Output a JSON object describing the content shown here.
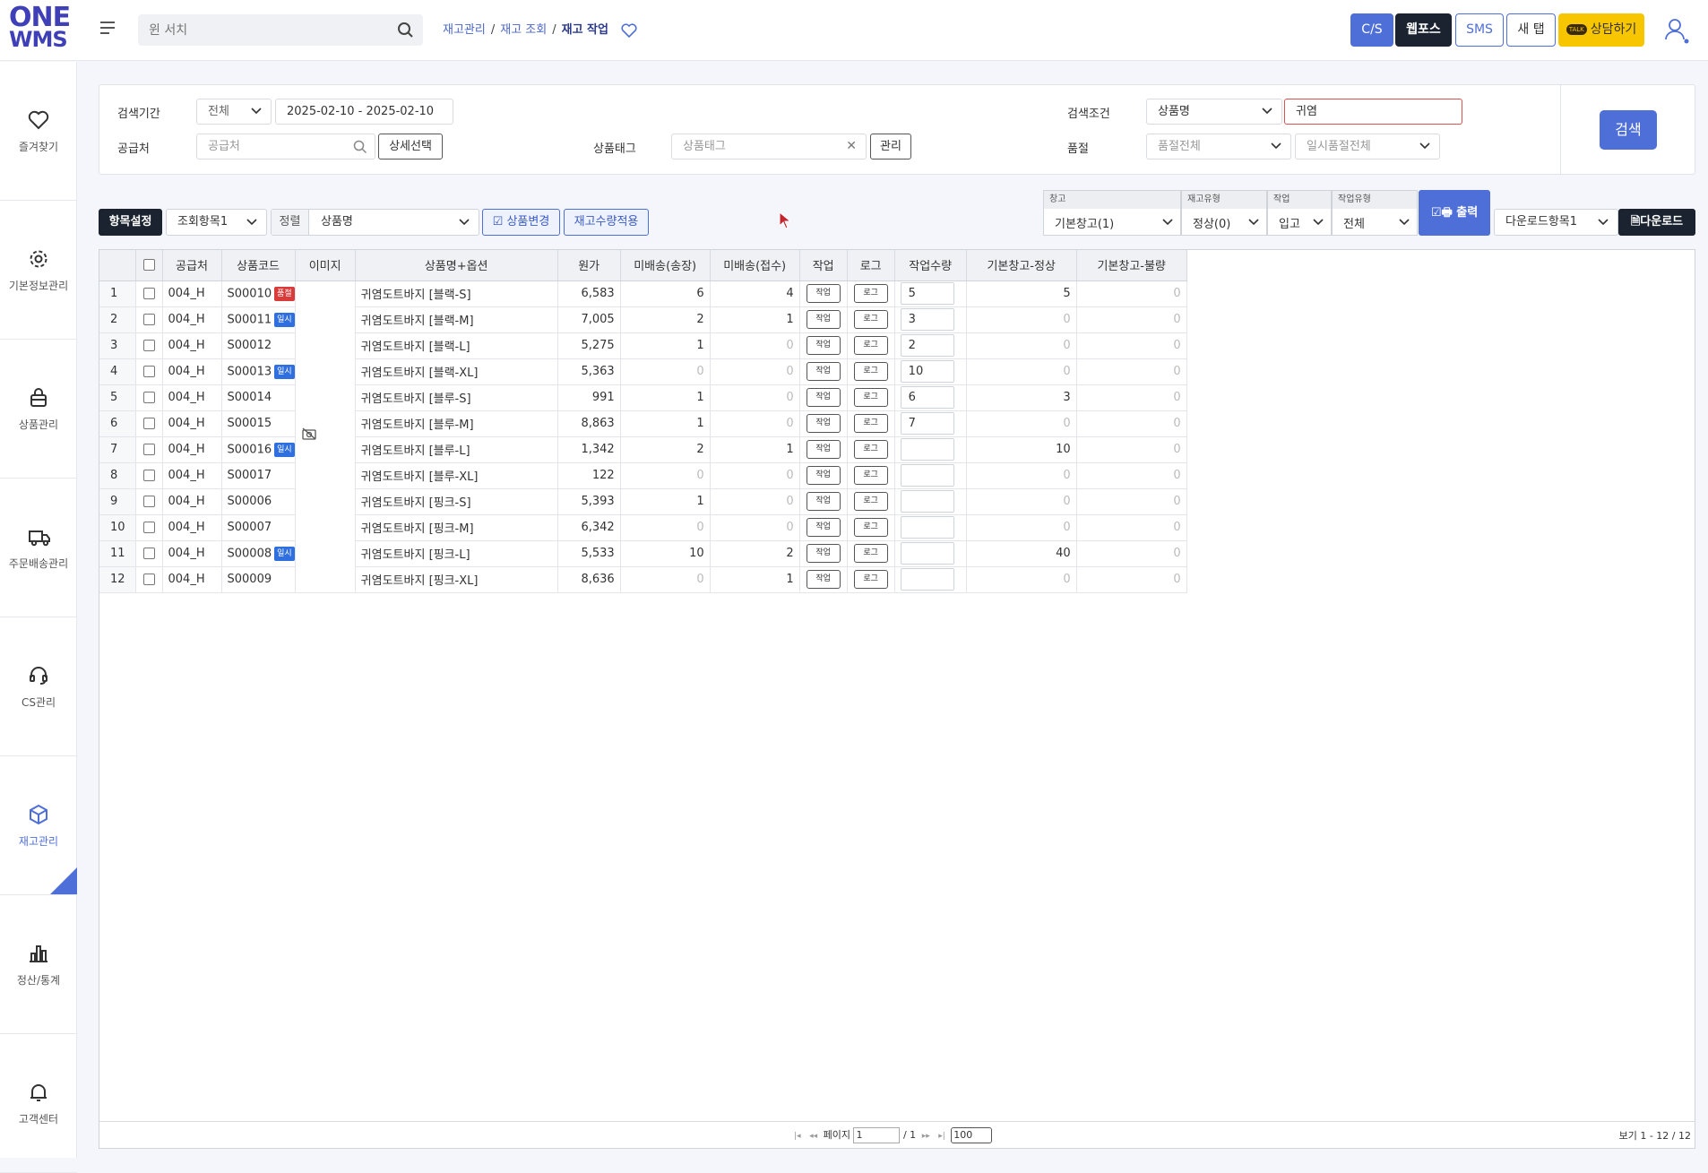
{
  "header": {
    "logo_line1": "ONE",
    "logo_line2": "WMS",
    "search_placeholder": "윈 서치",
    "breadcrumb": [
      "재고관리",
      "재고 조회",
      "재고 작업"
    ],
    "buttons": {
      "cs": "C/S",
      "webforce": "웹포스",
      "sms": "SMS",
      "new_tab": "새 탭",
      "talk_badge": "TALK",
      "consult": "상담하기"
    }
  },
  "sidebar": {
    "items": [
      {
        "label": "즐겨찾기",
        "icon": "heart-icon"
      },
      {
        "label": "기본정보관리",
        "icon": "gear-icon"
      },
      {
        "label": "상품관리",
        "icon": "bag-icon"
      },
      {
        "label": "주문배송관리",
        "icon": "truck-icon"
      },
      {
        "label": "CS관리",
        "icon": "headset-icon"
      },
      {
        "label": "재고관리",
        "icon": "box-icon",
        "active": true
      },
      {
        "label": "정산/통계",
        "icon": "bar-chart-icon"
      },
      {
        "label": "고객센터",
        "icon": "bell-icon"
      }
    ]
  },
  "filters": {
    "period_label": "검색기간",
    "period_select": "전체",
    "period_range": "2025-02-10 - 2025-02-10",
    "supplier_label": "공급처",
    "supplier_placeholder": "공급처",
    "detail_select": "상세선택",
    "tag_label": "상품태그",
    "tag_placeholder": "상품태그",
    "manage": "관리",
    "condition_label": "검색조건",
    "condition_select": "상품명",
    "condition_value": "귀염",
    "soldout_label": "품절",
    "soldout_all": "품절전체",
    "temp_soldout_all": "일시품절전체",
    "search_button": "검색"
  },
  "toolbar": {
    "item_setting": "항목설정",
    "view_item": "조회항목1",
    "sort_label": "정렬",
    "sort_value": "상품명",
    "product_change": "상품변경",
    "apply_stock": "재고수량적용",
    "warehouse_label": "창고",
    "warehouse_value": "기본창고(1)",
    "stock_type_label": "재고유형",
    "stock_type_value": "정상(0)",
    "work_label": "작업",
    "work_value": "입고",
    "work_type_label": "작업유형",
    "work_type_value": "전체",
    "print": "출력",
    "download_item": "다운로드항목1",
    "download": "다운로드"
  },
  "table": {
    "columns": [
      "공급처",
      "상품코드",
      "이미지",
      "상품명+옵션",
      "원가",
      "미배송(송장)",
      "미배송(접수)",
      "작업",
      "로그",
      "작업수량",
      "기본창고-정상",
      "기본창고-불량"
    ],
    "work_btn": "작업",
    "log_btn": "로그",
    "rows": [
      {
        "no": "1",
        "supplier": "004_H",
        "code": "S00010",
        "badge": "품절",
        "badge_color": "#d93a3a",
        "name": "귀염도트바지 [블랙-S]",
        "cost": "6,583",
        "ship_invoice": "6",
        "ship_receipt": "4",
        "qty": "5",
        "normal": "5",
        "defect": "0"
      },
      {
        "no": "2",
        "supplier": "004_H",
        "code": "S00011",
        "badge": "일시",
        "badge_color": "#2f6fe0",
        "name": "귀염도트바지 [블랙-M]",
        "cost": "7,005",
        "ship_invoice": "2",
        "ship_receipt": "1",
        "qty": "3",
        "normal": "0",
        "defect": "0"
      },
      {
        "no": "3",
        "supplier": "004_H",
        "code": "S00012",
        "badge": "",
        "badge_color": "",
        "name": "귀염도트바지 [블랙-L]",
        "cost": "5,275",
        "ship_invoice": "1",
        "ship_receipt": "0",
        "qty": "2",
        "normal": "0",
        "defect": "0"
      },
      {
        "no": "4",
        "supplier": "004_H",
        "code": "S00013",
        "badge": "일시",
        "badge_color": "#2f6fe0",
        "name": "귀염도트바지 [블랙-XL]",
        "cost": "5,363",
        "ship_invoice": "0",
        "ship_receipt": "0",
        "qty": "10",
        "normal": "0",
        "defect": "0"
      },
      {
        "no": "5",
        "supplier": "004_H",
        "code": "S00014",
        "badge": "",
        "badge_color": "",
        "name": "귀염도트바지 [블루-S]",
        "cost": "991",
        "ship_invoice": "1",
        "ship_receipt": "0",
        "qty": "6",
        "normal": "3",
        "defect": "0"
      },
      {
        "no": "6",
        "supplier": "004_H",
        "code": "S00015",
        "badge": "",
        "badge_color": "",
        "name": "귀염도트바지 [블루-M]",
        "cost": "8,863",
        "ship_invoice": "1",
        "ship_receipt": "0",
        "qty": "7",
        "normal": "0",
        "defect": "0"
      },
      {
        "no": "7",
        "supplier": "004_H",
        "code": "S00016",
        "badge": "일시",
        "badge_color": "#2f6fe0",
        "name": "귀염도트바지 [블루-L]",
        "cost": "1,342",
        "ship_invoice": "2",
        "ship_receipt": "1",
        "qty": "",
        "normal": "10",
        "defect": "0"
      },
      {
        "no": "8",
        "supplier": "004_H",
        "code": "S00017",
        "badge": "",
        "badge_color": "",
        "name": "귀염도트바지 [블루-XL]",
        "cost": "122",
        "ship_invoice": "0",
        "ship_receipt": "0",
        "qty": "",
        "normal": "0",
        "defect": "0"
      },
      {
        "no": "9",
        "supplier": "004_H",
        "code": "S00006",
        "badge": "",
        "badge_color": "",
        "name": "귀염도트바지 [핑크-S]",
        "cost": "5,393",
        "ship_invoice": "1",
        "ship_receipt": "0",
        "qty": "",
        "normal": "0",
        "defect": "0"
      },
      {
        "no": "10",
        "supplier": "004_H",
        "code": "S00007",
        "badge": "",
        "badge_color": "",
        "name": "귀염도트바지 [핑크-M]",
        "cost": "6,342",
        "ship_invoice": "0",
        "ship_receipt": "0",
        "qty": "",
        "normal": "0",
        "defect": "0"
      },
      {
        "no": "11",
        "supplier": "004_H",
        "code": "S00008",
        "badge": "일시",
        "badge_color": "#2f6fe0",
        "name": "귀염도트바지 [핑크-L]",
        "cost": "5,533",
        "ship_invoice": "10",
        "ship_receipt": "2",
        "qty": "",
        "normal": "40",
        "defect": "0"
      },
      {
        "no": "12",
        "supplier": "004_H",
        "code": "S00009",
        "badge": "",
        "badge_color": "",
        "name": "귀염도트바지 [핑크-XL]",
        "cost": "8,636",
        "ship_invoice": "0",
        "ship_receipt": "1",
        "qty": "",
        "normal": "0",
        "defect": "0"
      }
    ]
  },
  "pager": {
    "page_label": "페이지",
    "page_value": "1",
    "total_pages": "/ 1",
    "rows_per_page": "100",
    "info": "보기 1 - 12 / 12"
  },
  "colors": {
    "accent": "#4f6fd8",
    "dark": "#1b2330",
    "talk": "#f7c600"
  }
}
